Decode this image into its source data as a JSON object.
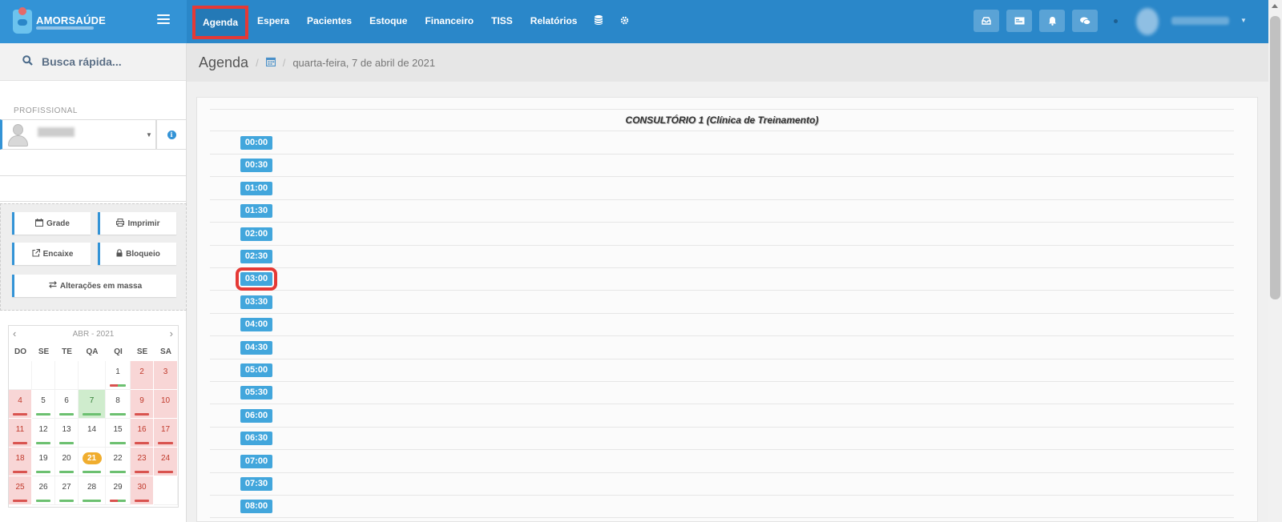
{
  "brand": {
    "name": "AMORSAÚDE"
  },
  "nav": {
    "items": [
      "Agenda",
      "Espera",
      "Pacientes",
      "Estoque",
      "Financeiro",
      "TISS",
      "Relatórios"
    ],
    "icons": [
      "database-icon",
      "gear-icon"
    ]
  },
  "topbar": {
    "buttons": [
      "inbox-icon",
      "card-icon",
      "bell-icon",
      "chat-icon"
    ]
  },
  "sidebar": {
    "search_label": "Busca rápida...",
    "professional_label": "PROFISSIONAL",
    "buttons": {
      "grade": "Grade",
      "imprimir": "Imprimir",
      "encaixe": "Encaixe",
      "bloqueio": "Bloqueio",
      "alteracoes": "Alterações em massa"
    }
  },
  "calendar": {
    "month_label": "ABR - 2021",
    "weekdays": [
      "DO",
      "SE",
      "TE",
      "QA",
      "QI",
      "SE",
      "SA"
    ],
    "weeks": [
      [
        null,
        null,
        null,
        null,
        "1",
        "2",
        "3"
      ],
      [
        "4",
        "5",
        "6",
        "7",
        "8",
        "9",
        "10"
      ],
      [
        "11",
        "12",
        "13",
        "14",
        "15",
        "16",
        "17"
      ],
      [
        "18",
        "19",
        "20",
        "21",
        "22",
        "23",
        "24"
      ],
      [
        "25",
        "26",
        "27",
        "28",
        "29",
        "30",
        null
      ]
    ],
    "selected_day": "7",
    "today": "21"
  },
  "breadcrumb": {
    "title": "Agenda",
    "date": "quarta-feira, 7 de abril de 2021"
  },
  "schedule": {
    "column_header": "CONSULTÓRIO 1 (Clínica de Treinamento)",
    "times": [
      "00:00",
      "00:30",
      "01:00",
      "01:30",
      "02:00",
      "02:30",
      "03:00",
      "03:30",
      "04:00",
      "04:30",
      "05:00",
      "05:30",
      "06:00",
      "06:30",
      "07:00",
      "07:30",
      "08:00"
    ]
  },
  "colors": {
    "topbar": "#2a87c9",
    "accent": "#3393d6",
    "time_badge": "#42a6dc",
    "highlight": "#e53935",
    "today": "#f0ad2e"
  }
}
